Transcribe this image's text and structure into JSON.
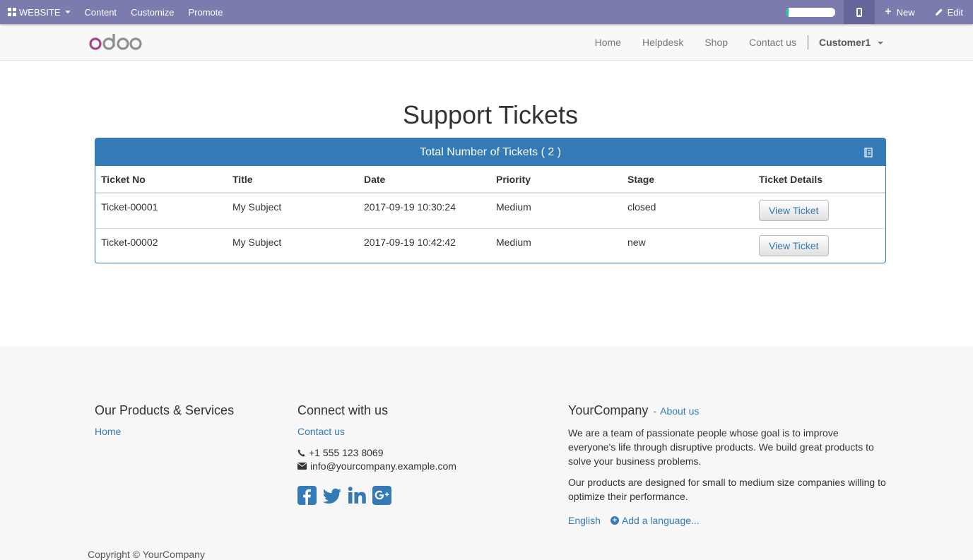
{
  "adminbar": {
    "website_label": "WEBSITE",
    "menu": [
      "Content",
      "Customize",
      "Promote"
    ],
    "progress_fraction": 0.05,
    "new_label": "New",
    "edit_label": "Edit",
    "bg_color": "#7c7bad"
  },
  "header": {
    "logo_text": "odoo",
    "nav": [
      "Home",
      "Helpdesk",
      "Shop",
      "Contact us"
    ],
    "user": "Customer1"
  },
  "main": {
    "title": "Support Tickets",
    "panel_heading": "Total Number of Tickets ( 2 )",
    "columns": [
      "Ticket No",
      "Title",
      "Date",
      "Priority",
      "Stage",
      "Ticket Details"
    ],
    "rows": [
      {
        "ticket_no": "Ticket-00001",
        "title": "My Subject",
        "date": "2017-09-19 10:30:24",
        "priority": "Medium",
        "stage": "closed",
        "button": "View Ticket"
      },
      {
        "ticket_no": "Ticket-00002",
        "title": "My Subject",
        "date": "2017-09-19 10:42:42",
        "priority": "Medium",
        "stage": "new",
        "button": "View Ticket"
      }
    ],
    "accent_color": "#337ab7"
  },
  "footer": {
    "products": {
      "heading": "Our Products & Services",
      "links": [
        "Home"
      ]
    },
    "connect": {
      "heading": "Connect with us",
      "link": "Contact us",
      "phone": "+1 555 123 8069",
      "email": "info@yourcompany.example.com",
      "socials": [
        "facebook-icon",
        "twitter-icon",
        "linkedin-icon",
        "google-plus-icon"
      ]
    },
    "company": {
      "name": "YourCompany",
      "dash": "-",
      "about": "About us",
      "p1": "We are a team of passionate people whose goal is to improve everyone's life through disruptive products. We build great products to solve your business problems.",
      "p2": "Our products are designed for small to medium size companies willing to optimize their performance.",
      "language": "English",
      "add_language": "Add a language..."
    },
    "copyright": "Copyright © YourCompany"
  }
}
